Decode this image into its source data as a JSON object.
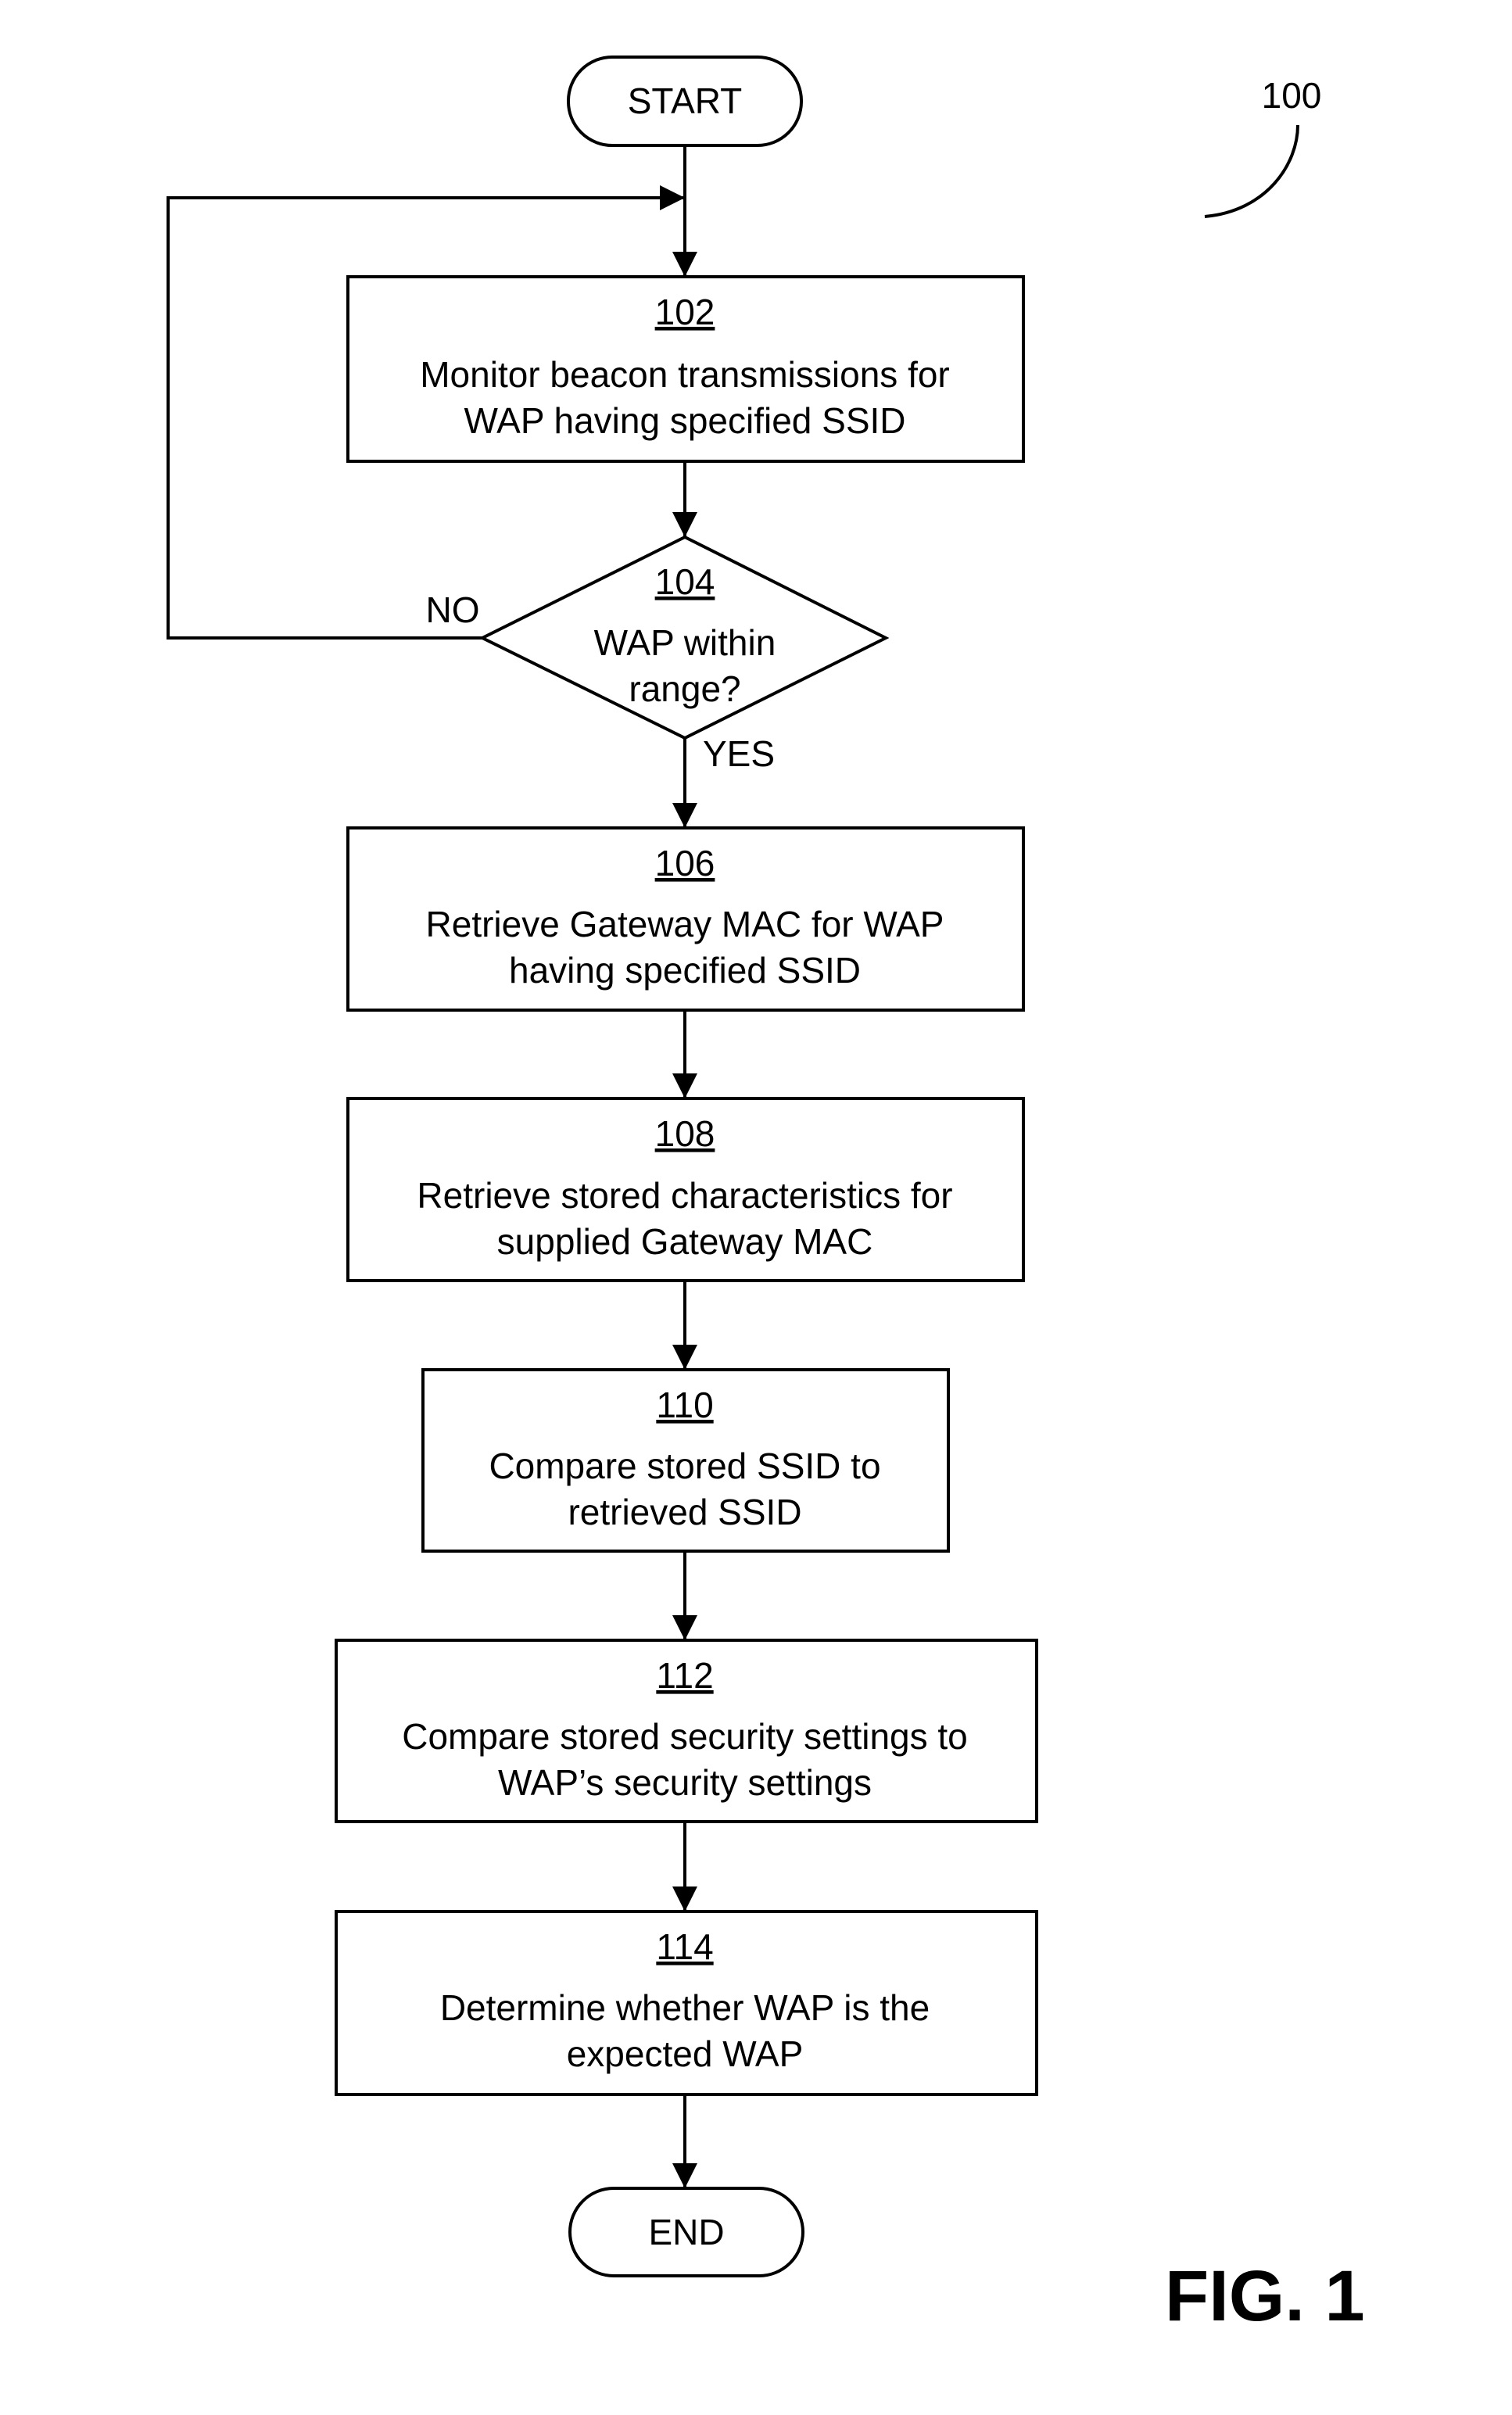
{
  "figure": {
    "label": "FIG. 1",
    "reference_number": "100"
  },
  "terminals": {
    "start": "START",
    "end": "END"
  },
  "steps": [
    {
      "id": "102",
      "lines": [
        "Monitor beacon transmissions for",
        "WAP having specified SSID"
      ]
    },
    {
      "id": "106",
      "lines": [
        "Retrieve Gateway MAC for WAP",
        "having specified SSID"
      ]
    },
    {
      "id": "108",
      "lines": [
        "Retrieve stored characteristics for",
        "supplied Gateway MAC"
      ]
    },
    {
      "id": "110",
      "lines": [
        "Compare stored SSID to",
        "retrieved SSID"
      ]
    },
    {
      "id": "112",
      "lines": [
        "Compare stored security settings to",
        "WAP’s security settings"
      ]
    },
    {
      "id": "114",
      "lines": [
        "Determine whether WAP is the",
        "expected WAP"
      ]
    }
  ],
  "decision": {
    "id": "104",
    "lines": [
      "WAP within",
      "range?"
    ],
    "no_label": "NO",
    "yes_label": "YES"
  }
}
